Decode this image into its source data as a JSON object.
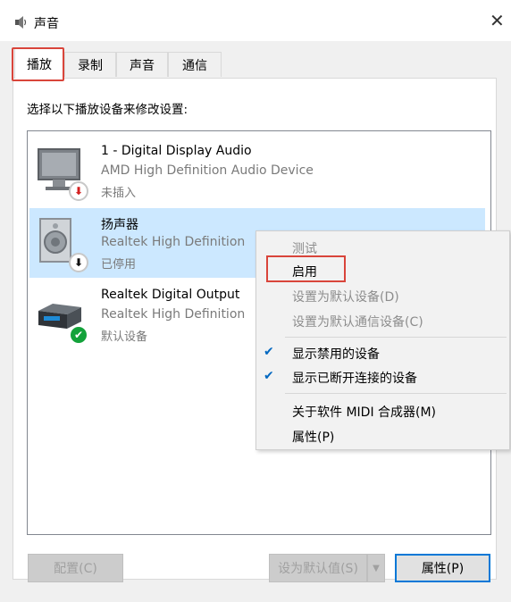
{
  "window": {
    "title": "声音",
    "close_glyph": "✕"
  },
  "tabs": [
    {
      "label": "播放"
    },
    {
      "label": "录制"
    },
    {
      "label": "声音"
    },
    {
      "label": "通信"
    }
  ],
  "panel": {
    "instruction": "选择以下播放设备来修改设置:"
  },
  "devices": [
    {
      "name": "1 - Digital Display Audio",
      "description": "AMD High Definition Audio Device",
      "status": "未插入",
      "icon": "monitor-icon",
      "badge": "unplugged-badge"
    },
    {
      "name": "扬声器",
      "description": "Realtek High Definition",
      "status": "已停用",
      "icon": "speaker-icon",
      "badge": "disabled-badge",
      "selected": true
    },
    {
      "name": "Realtek Digital Output",
      "description": "Realtek High Definition",
      "status": "默认设备",
      "icon": "digital-output-icon",
      "badge": "default-check-badge"
    }
  ],
  "context_menu": {
    "items": [
      {
        "label": "测试",
        "disabled": true
      },
      {
        "label": "启用",
        "disabled": false
      },
      {
        "label": "设置为默认设备(D)",
        "disabled": true
      },
      {
        "label": "设置为默认通信设备(C)",
        "disabled": true
      },
      {
        "label": "显示禁用的设备",
        "checked": true
      },
      {
        "label": "显示已断开连接的设备",
        "checked": true
      },
      {
        "label": "关于软件 MIDI 合成器(M)",
        "disabled": false
      },
      {
        "label": "属性(P)",
        "disabled": false
      }
    ]
  },
  "buttons": {
    "configure": "配置(C)",
    "set_default": "设为默认值(S)",
    "properties": "属性(P)"
  },
  "colors": {
    "accent": "#0078d7",
    "highlight": "#d9453b",
    "selected_row": "#cce8ff"
  }
}
